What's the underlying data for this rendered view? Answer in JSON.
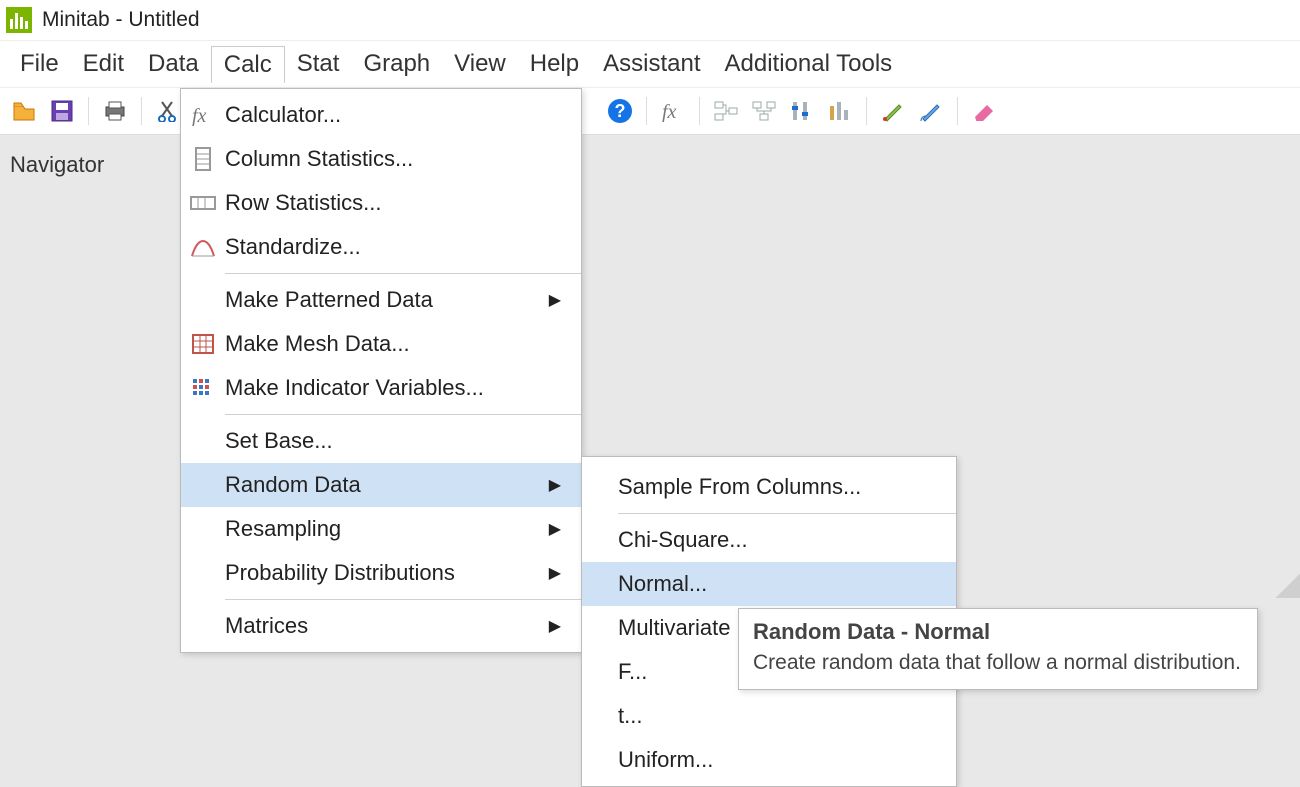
{
  "window": {
    "title": "Minitab - Untitled"
  },
  "menubar": {
    "items": [
      "File",
      "Edit",
      "Data",
      "Calc",
      "Stat",
      "Graph",
      "View",
      "Help",
      "Assistant",
      "Additional Tools"
    ],
    "active_index": 3
  },
  "navigator": {
    "title": "Navigator"
  },
  "calc_menu": {
    "items": [
      {
        "label": "Calculator...",
        "icon": "fx-icon"
      },
      {
        "label": "Column Statistics...",
        "icon": "column-stats-icon"
      },
      {
        "label": "Row Statistics...",
        "icon": "row-stats-icon"
      },
      {
        "label": "Standardize...",
        "icon": "standardize-icon",
        "sep_after": true
      },
      {
        "label": "Make Patterned Data",
        "submenu": true
      },
      {
        "label": "Make Mesh Data...",
        "icon": "mesh-icon"
      },
      {
        "label": "Make Indicator Variables...",
        "icon": "indicator-icon",
        "sep_after": true
      },
      {
        "label": "Set Base..."
      },
      {
        "label": "Random Data",
        "submenu": true,
        "highlighted": true
      },
      {
        "label": "Resampling",
        "submenu": true
      },
      {
        "label": "Probability Distributions",
        "submenu": true,
        "sep_after": true
      },
      {
        "label": "Matrices",
        "submenu": true
      }
    ]
  },
  "random_submenu": {
    "items": [
      {
        "label": "Sample From Columns...",
        "sep_after": true
      },
      {
        "label": "Chi-Square..."
      },
      {
        "label": "Normal...",
        "highlighted": true
      },
      {
        "label": "Multivariate Normal..."
      },
      {
        "label": "F..."
      },
      {
        "label": "t..."
      },
      {
        "label": "Uniform..."
      }
    ]
  },
  "tooltip": {
    "title": "Random Data - Normal",
    "body": "Create random data that follow a normal distribution."
  }
}
